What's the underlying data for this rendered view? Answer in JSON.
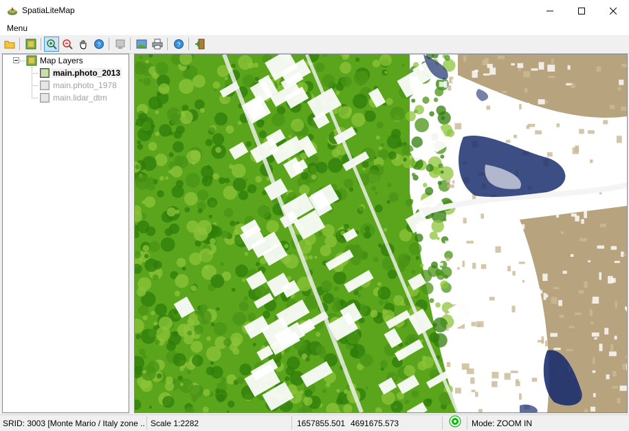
{
  "window": {
    "title": "SpatiaLiteMap"
  },
  "menu": {
    "label": "Menu"
  },
  "toolbar": {
    "items": [
      {
        "icon": "open-folder-icon"
      },
      {
        "icon": "layer-config-icon"
      },
      {
        "icon": "zoom-in-icon",
        "active": true
      },
      {
        "icon": "zoom-out-icon"
      },
      {
        "icon": "pan-hand-icon"
      },
      {
        "icon": "identify-icon"
      },
      {
        "icon": "disabled-tool-icon"
      },
      {
        "icon": "export-image-icon"
      },
      {
        "icon": "print-icon"
      },
      {
        "icon": "help-icon"
      },
      {
        "icon": "exit-icon"
      }
    ]
  },
  "tree": {
    "root_label": "Map Layers",
    "layers": [
      {
        "label": "main.photo_2013",
        "active": true
      },
      {
        "label": "main.photo_1978",
        "active": false
      },
      {
        "label": "main.lidar_dtm",
        "active": false
      }
    ]
  },
  "status": {
    "srid": "SRID: 3003 [Monte Mario / Italy zone ...",
    "scale": "Scale 1:2282",
    "x": "1657855.501",
    "y": "4691675.573",
    "indicator_color": "#00c000",
    "mode": "Mode: ZOOM IN"
  },
  "map": {
    "colors": {
      "vegetation_dark": "#2f7d0a",
      "vegetation": "#5aa51c",
      "vegetation_light": "#8cc43a",
      "building": "#ffffff",
      "bare_soil": "#b7a37e",
      "water": "#1b2f6e"
    }
  }
}
